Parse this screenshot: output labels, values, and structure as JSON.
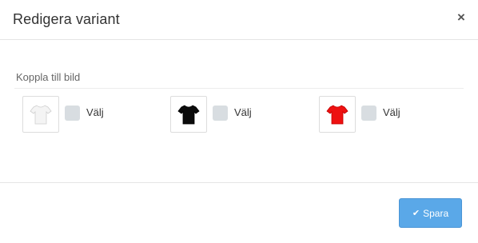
{
  "modal": {
    "title": "Redigera variant",
    "close_glyph": "×"
  },
  "section": {
    "label": "Koppla till bild"
  },
  "variants": [
    {
      "color": "#f4f4f4",
      "outline": "#cfcfcf",
      "checkbox_label": "Välj",
      "checked": false
    },
    {
      "color": "#0b0b0b",
      "outline": "#000000",
      "checkbox_label": "Välj",
      "checked": false
    },
    {
      "color": "#ee1111",
      "outline": "#c00000",
      "checkbox_label": "Välj",
      "checked": false
    }
  ],
  "footer": {
    "save_icon": "✔",
    "save_label": "Spara",
    "save_color": "#5aa8e8"
  }
}
